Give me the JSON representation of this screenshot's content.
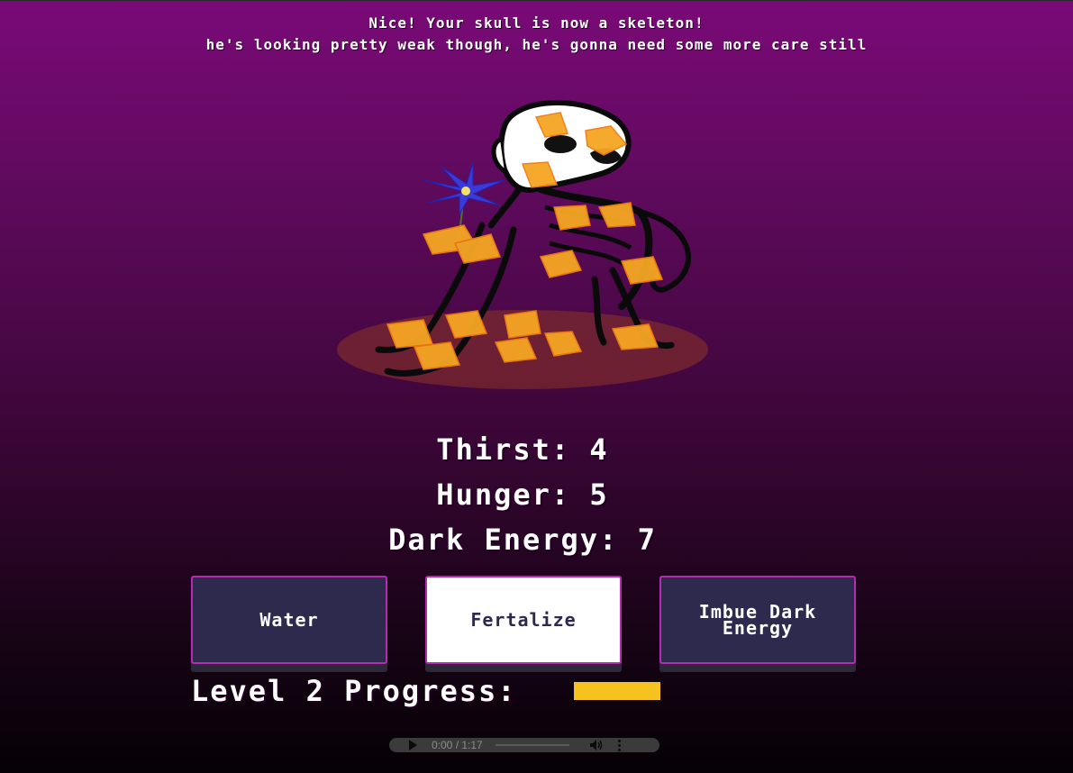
{
  "message": {
    "line1": "Nice! Your skull is now a skeleton!",
    "line2": "he's looking pretty weak though, he's gonna need some more care still"
  },
  "stats": {
    "thirst": "Thirst: 4",
    "hunger": "Hunger: 5",
    "dark_energy": "Dark Energy: 7"
  },
  "buttons": {
    "water": "Water",
    "fertilize": "Fertalize",
    "imbue": "Imbue Dark Energy"
  },
  "progress": {
    "label": "Level 2 Progress:",
    "value_fraction": 1.0,
    "color": "#f6c21f"
  },
  "audio": {
    "time": "0:00 / 1:17",
    "icons": [
      "play-icon",
      "volume-icon",
      "more-options-icon"
    ]
  },
  "colors": {
    "button_bg": "#2e2a4e",
    "button_border": "#b52ab0",
    "selected_button_bg": "#ffffff"
  }
}
